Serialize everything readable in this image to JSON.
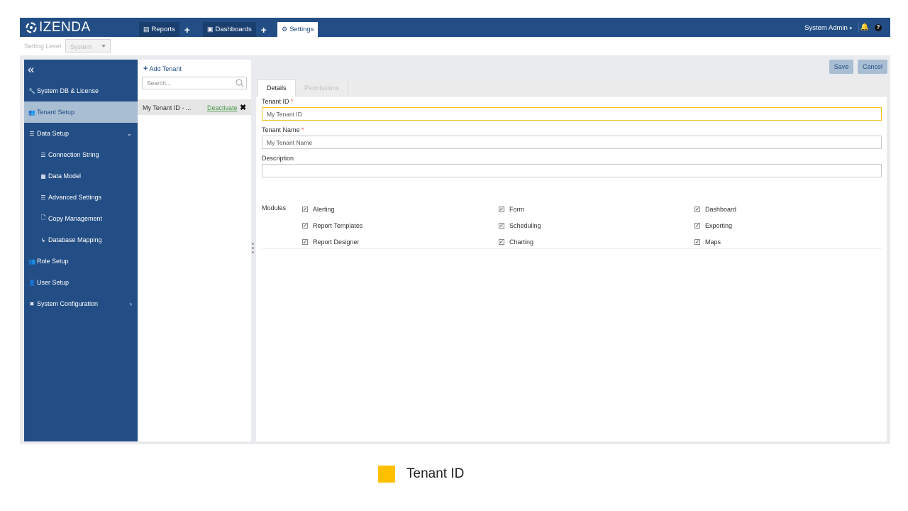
{
  "header": {
    "logo_text": "IZENDA",
    "nav": {
      "reports": "Reports",
      "dashboards": "Dashboards",
      "settings": "Settings"
    },
    "user": "System Admin",
    "help_glyph": "?"
  },
  "setting_level": {
    "label": "Setting Level",
    "value": "System"
  },
  "sidebar": {
    "items": [
      {
        "label": "System DB & License"
      },
      {
        "label": "Tenant Setup"
      },
      {
        "label": "Data Setup"
      },
      {
        "label": "Connection String"
      },
      {
        "label": "Data Model"
      },
      {
        "label": "Advanced Settings"
      },
      {
        "label": "Copy Management"
      },
      {
        "label": "Database Mapping"
      },
      {
        "label": "Role Setup"
      },
      {
        "label": "User Setup"
      },
      {
        "label": "System Configuration"
      }
    ]
  },
  "tenant_list": {
    "add_label": "Add Tenant",
    "search_placeholder": "Search...",
    "rows": [
      {
        "name": "My Tenant ID - ...",
        "action": "Deactivate"
      }
    ]
  },
  "actions": {
    "save": "Save",
    "cancel": "Cancel"
  },
  "tabs": {
    "details": "Details",
    "permissions": "Permissions"
  },
  "form": {
    "tenant_id_label": "Tenant ID",
    "tenant_id_value": "My Tenant ID",
    "tenant_name_label": "Tenant Name",
    "tenant_name_value": "My Tenant Name",
    "description_label": "Description",
    "description_value": "",
    "required_mark": "*",
    "modules_label": "Modules",
    "modules": [
      {
        "label": "Alerting",
        "checked": true
      },
      {
        "label": "Form",
        "checked": true
      },
      {
        "label": "Dashboard",
        "checked": true
      },
      {
        "label": "Report Templates",
        "checked": true
      },
      {
        "label": "Scheduling",
        "checked": true
      },
      {
        "label": "Exporting",
        "checked": true
      },
      {
        "label": "Report Designer",
        "checked": true
      },
      {
        "label": "Charting",
        "checked": true
      },
      {
        "label": "Maps",
        "checked": true
      }
    ]
  },
  "legend": {
    "label": "Tenant ID",
    "color": "#ffc000"
  },
  "colors": {
    "brand_blue": "#234e85",
    "active_light": "#a9bdd3",
    "focus_border": "#f0c419",
    "link_green": "#4a9a4a"
  }
}
